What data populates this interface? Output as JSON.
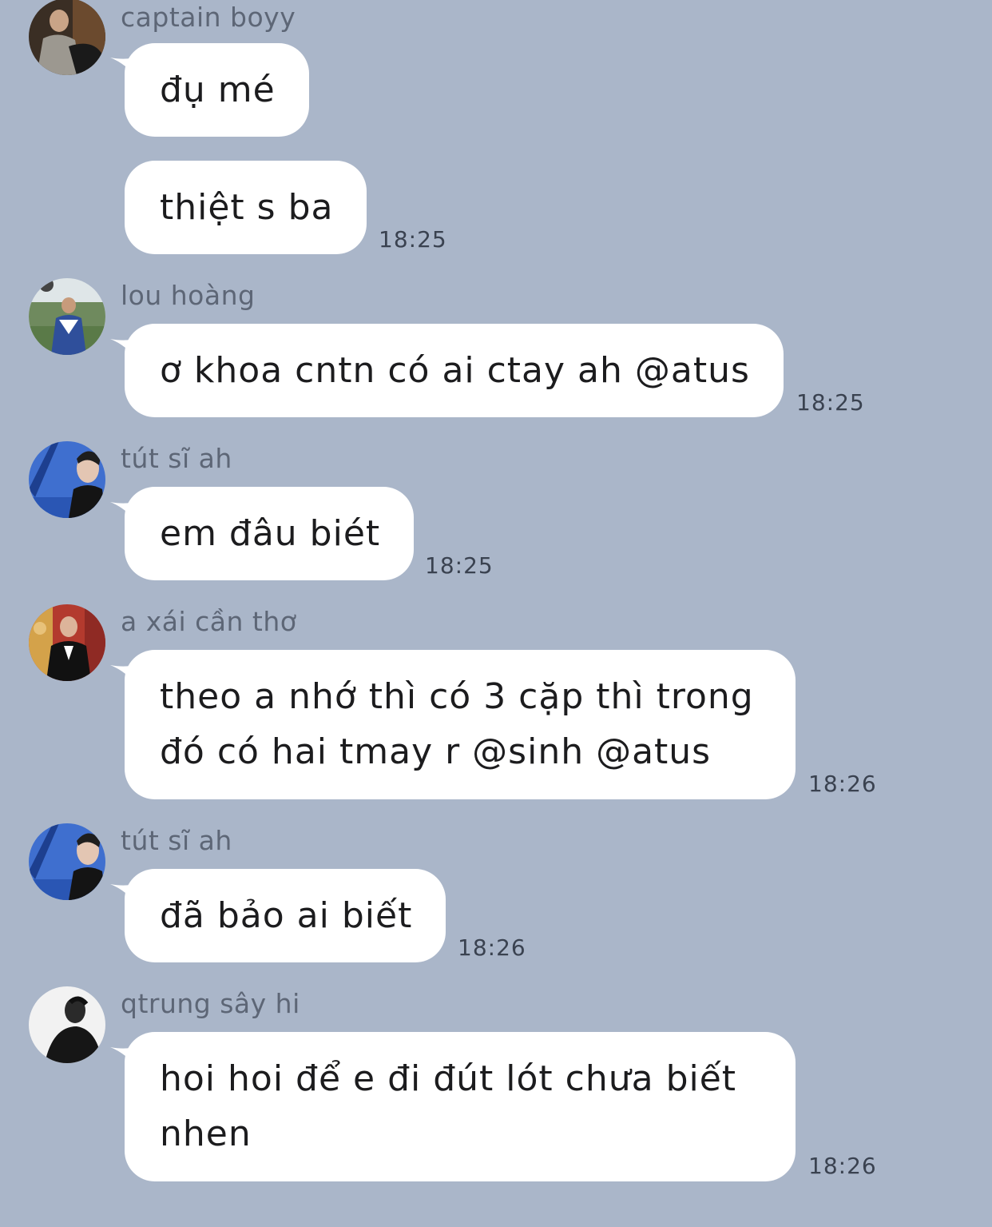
{
  "messages": [
    {
      "sender": "captain boyy",
      "avatar": "avatar-photo-dark",
      "bubbles": [
        "đụ mé",
        "thiệt s ba"
      ],
      "time": "18:25"
    },
    {
      "sender": "lou hoàng",
      "avatar": "avatar-photo-outdoor",
      "bubbles": [
        "ơ khoa cntn có ai ctay ah @atus"
      ],
      "time": "18:25"
    },
    {
      "sender": "tút sĩ ah",
      "avatar": "avatar-photo-blue",
      "bubbles": [
        "em đâu biét"
      ],
      "time": "18:25"
    },
    {
      "sender": "a xái cần thơ",
      "avatar": "avatar-photo-red",
      "bubbles": [
        "theo a nhớ thì có 3 cặp thì trong đó có hai tmay r @sinh @atus"
      ],
      "time": "18:26"
    },
    {
      "sender": "tút sĩ ah",
      "avatar": "avatar-photo-blue",
      "bubbles": [
        "đã bảo ai biết"
      ],
      "time": "18:26"
    },
    {
      "sender": "qtrung sây hi",
      "avatar": "avatar-photo-bw",
      "bubbles": [
        "hoi hoi để e đi đút lót chưa biết nhen"
      ],
      "time": "18:26"
    }
  ],
  "colors": {
    "background": "#aab6c9",
    "bubble": "#ffffff",
    "sender_text": "#5d6676",
    "time_text": "#3a4250"
  }
}
